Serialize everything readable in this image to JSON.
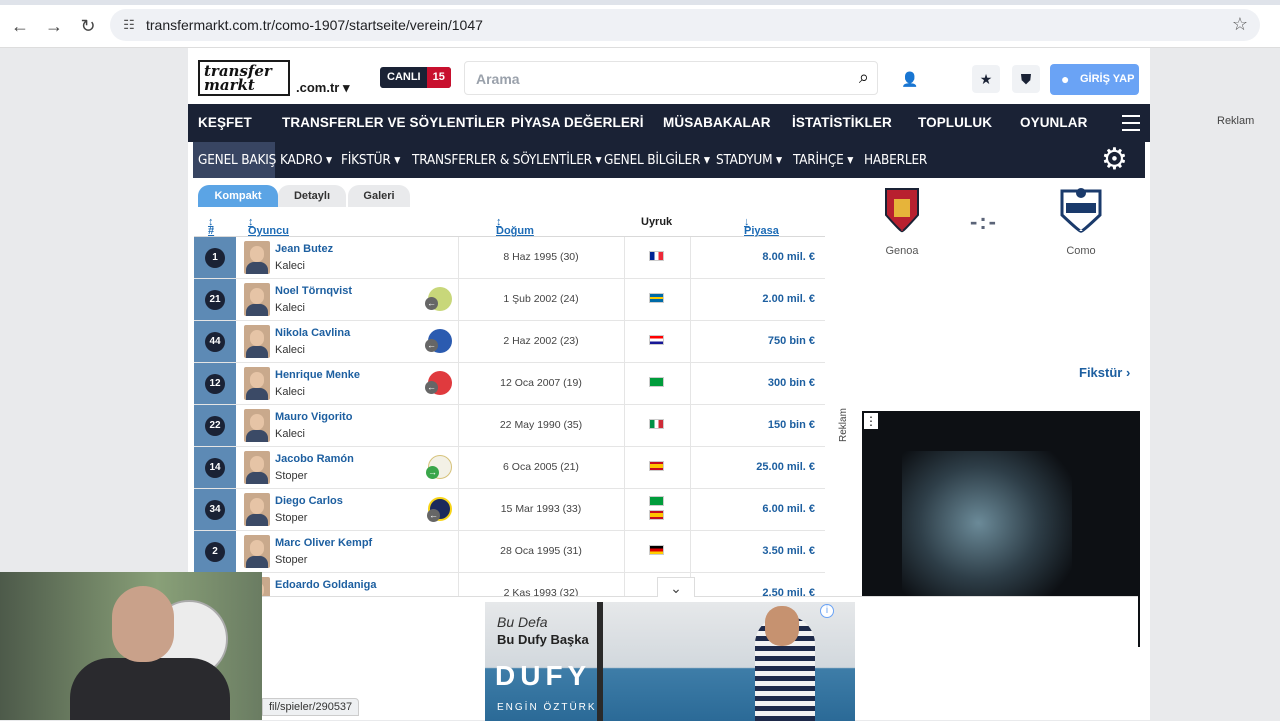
{
  "browser": {
    "url": "transfermarkt.com.tr/como-1907/startseite/verein/1047"
  },
  "site": {
    "logo_text": "transfer markt",
    "tld": ".com.tr",
    "live_label": "CANLI",
    "live_count": "15",
    "search_placeholder": "Arama",
    "login_label": "GİRİŞ YAP"
  },
  "main_nav": [
    "KEŞFET",
    "TRANSFERLER VE SÖYLENTİLER",
    "PİYASA DEĞERLERİ",
    "MÜSABAKALAR",
    "İSTATİSTİKLER",
    "TOPLULUK",
    "OYUNLAR"
  ],
  "sub_nav": [
    "GENEL BAKIŞ",
    "KADRO",
    "FİKSTÜR",
    "TRANSFERLER & SÖYLENTİLER",
    "GENEL BİLGİLER",
    "STADYUM",
    "TARİHÇE",
    "HABERLER"
  ],
  "tabs": [
    "Kompakt",
    "Detaylı",
    "Galeri"
  ],
  "table": {
    "headers": {
      "num": "#",
      "player": "Oyuncu",
      "dob": "Doğum tarihi/Yaş",
      "nat": "Uyruk",
      "value": "Piyasa değeri"
    },
    "rows": [
      {
        "num": "1",
        "name": "Jean Butez",
        "pos": "Kaleci",
        "dob": "8 Haz 1995 (30)",
        "value": "8.00 mil. €"
      },
      {
        "num": "21",
        "name": "Noel Törnqvist",
        "pos": "Kaleci",
        "dob": "1 Şub 2002 (24)",
        "value": "2.00 mil. €"
      },
      {
        "num": "44",
        "name": "Nikola Cavlina",
        "pos": "Kaleci",
        "dob": "2 Haz 2002 (23)",
        "value": "750 bin €"
      },
      {
        "num": "12",
        "name": "Henrique Menke",
        "pos": "Kaleci",
        "dob": "12 Oca 2007 (19)",
        "value": "300 bin €"
      },
      {
        "num": "22",
        "name": "Mauro Vigorito",
        "pos": "Kaleci",
        "dob": "22 May 1990 (35)",
        "value": "150 bin €"
      },
      {
        "num": "14",
        "name": "Jacobo Ramón",
        "pos": "Stoper",
        "dob": "6 Oca 2005 (21)",
        "value": "25.00 mil. €"
      },
      {
        "num": "34",
        "name": "Diego Carlos",
        "pos": "Stoper",
        "dob": "15 Mar 1993 (33)",
        "value": "6.00 mil. €"
      },
      {
        "num": "2",
        "name": "Marc Oliver Kempf",
        "pos": "Stoper",
        "dob": "28 Oca 1995 (31)",
        "value": "3.50 mil. €"
      },
      {
        "num": "",
        "name": "Edoardo Goldaniga",
        "pos": "",
        "dob": "2 Kas 1993 (32)",
        "value": "2.50 mil. €"
      }
    ]
  },
  "sidebar": {
    "home_team": "Genoa",
    "away_team": "Como",
    "score": "-:-",
    "fixture_link": "Fikstür",
    "ad_label": "Reklam"
  },
  "right_ad_label": "Reklam",
  "bottom_ad": {
    "line1": "Bu Defa",
    "line2": "Bu Dufy Başka",
    "brand": "DUFY",
    "sub": "ENGİN ÖZTÜRK"
  },
  "status_link": "fil/spieler/290537",
  "colors": {
    "navy": "#1a2235",
    "link": "#1d5fa0",
    "accent": "#5ba4e5"
  }
}
